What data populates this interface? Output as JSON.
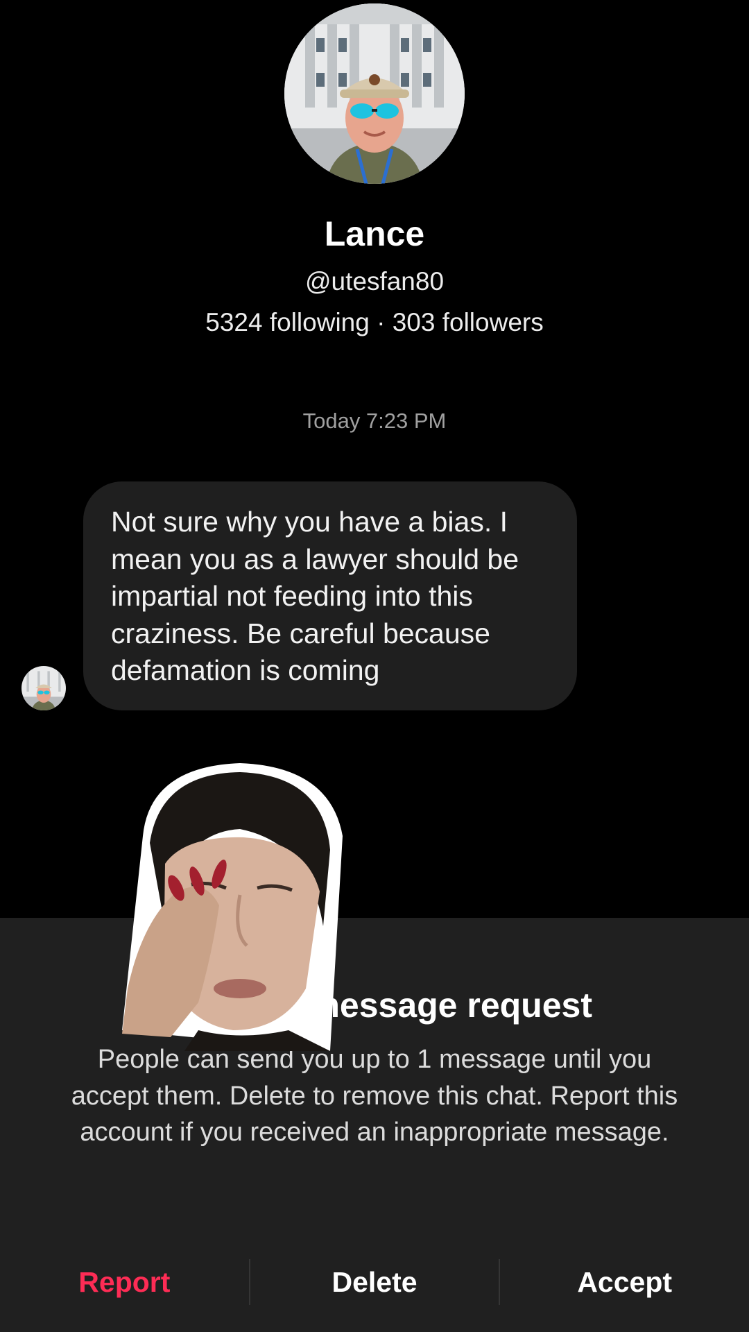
{
  "profile": {
    "name": "Lance",
    "handle": "@utesfan80",
    "stats": "5324 following · 303 followers",
    "avatar": "avatar-photo"
  },
  "conversation": {
    "timestamp": "Today 7:23 PM",
    "message": "Not sure why you have a bias. I mean you as a lawyer should be impartial not feeding into this craziness. Be careful because defamation is coming"
  },
  "sheet": {
    "title_visible": "Lan ou a message request",
    "description": "People can send you up to 1 message until you accept them. Delete to remove this chat. Report this account if you received an inappropriate message.",
    "actions": {
      "report": "Report",
      "delete": "Delete",
      "accept": "Accept"
    }
  },
  "colors": {
    "background": "#000000",
    "bubble": "#1f1f1f",
    "sheet": "#202020",
    "report": "#fe2c55"
  }
}
